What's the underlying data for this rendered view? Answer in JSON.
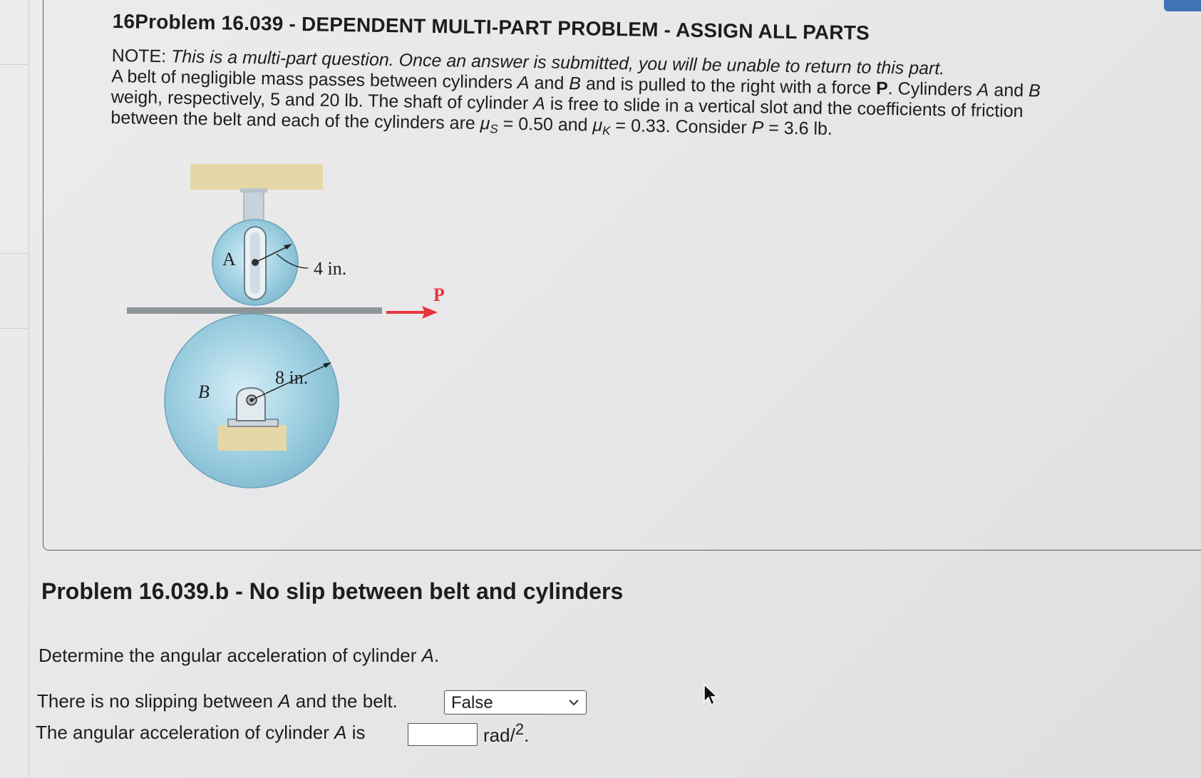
{
  "header": {
    "title": "16Problem 16.039 - DEPENDENT MULTI-PART PROBLEM - ASSIGN ALL PARTS"
  },
  "intro": {
    "note_label": "NOTE:",
    "note_text": "This is a multi-part question. Once an answer is submitted, you will be unable to return to this part.",
    "line2_a": "A belt of negligible mass passes between cylinders ",
    "line2_varA": "A",
    "line2_b": " and ",
    "line2_varB": "B",
    "line2_c": " and is pulled to the right with a force ",
    "line2_P": "P",
    "line2_d": ". Cylinders ",
    "line2_varA2": "A",
    "line2_e": " and ",
    "line2_varB2": "B",
    "line3_a": "weigh, respectively, 5 and 20 lb. The shaft of cylinder ",
    "line3_varA": "A",
    "line3_b": " is free to slide in a vertical slot and the coefficients of friction",
    "line4_a": "between the belt and each of the cylinders are ",
    "mu": "μ",
    "mu_s_sub": "S",
    "line4_b": " = 0.50 and ",
    "mu_k_sub": "K",
    "line4_c": " = 0.33. Consider ",
    "line4_P": "P",
    "line4_d": " = 3.6 lb."
  },
  "figure": {
    "label_A": "A",
    "label_B": "B",
    "radius_A": "4 in.",
    "radius_B": "8 in.",
    "force_label": "P",
    "colors": {
      "cylinder": "#8fc4d8",
      "support": "#e6d7a6",
      "force_arrow": "#e8343c"
    }
  },
  "part": {
    "title": "Problem 16.039.b - No slip between belt and cylinders",
    "question_a": "Determine the angular acceleration of cylinder ",
    "question_var": "A",
    "question_b": ".",
    "no_slip_a": "There is no slipping between ",
    "no_slip_var": "A",
    "no_slip_b": " and the belt.",
    "select_value": "False",
    "answer_a": "The angular acceleration of cylinder ",
    "answer_var": "A",
    "answer_b": " is",
    "answer_value": "",
    "units_main": "rad/",
    "units_sup": "2",
    "units_end": "."
  }
}
